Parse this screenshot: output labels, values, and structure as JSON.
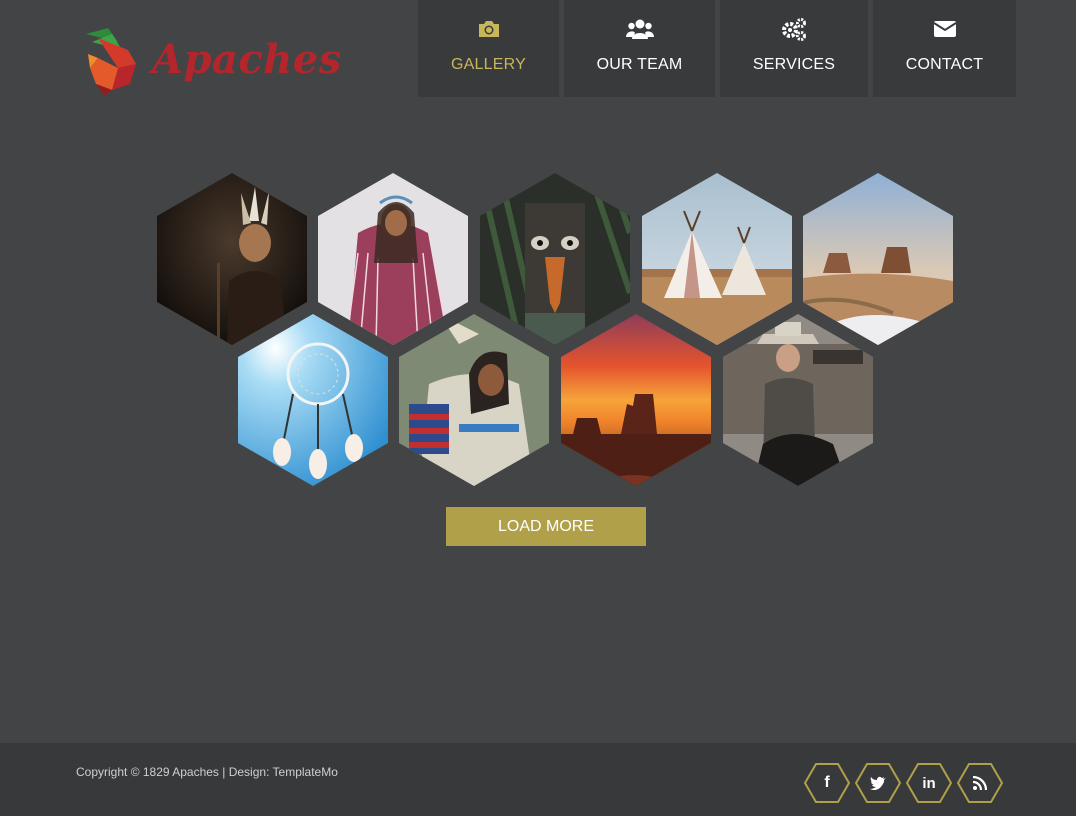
{
  "header": {
    "logo_text": "Apaches"
  },
  "nav": {
    "items": [
      {
        "label": "GALLERY",
        "icon": "camera-icon",
        "active": true
      },
      {
        "label": "OUR TEAM",
        "icon": "users-icon",
        "active": false
      },
      {
        "label": "SERVICES",
        "icon": "gears-icon",
        "active": false
      },
      {
        "label": "CONTACT",
        "icon": "envelope-icon",
        "active": false
      }
    ]
  },
  "gallery": {
    "items": [
      {
        "subject": "headdress-warrior-photo"
      },
      {
        "subject": "fringed-shawl-woman-photo"
      },
      {
        "subject": "totem-pole-photo"
      },
      {
        "subject": "teepee-camp-photo"
      },
      {
        "subject": "monument-valley-photo"
      },
      {
        "subject": "dreamcatcher-photo"
      },
      {
        "subject": "regalia-dancer-photo"
      },
      {
        "subject": "sunset-mesa-photo"
      },
      {
        "subject": "cowboy-rider-photo"
      }
    ],
    "load_more_label": "LOAD MORE"
  },
  "footer": {
    "copyright": "Copyright © 1829 Apaches | Design: TemplateMo",
    "social": [
      {
        "name": "facebook-icon",
        "glyph": "f"
      },
      {
        "name": "twitter-icon",
        "glyph": "t"
      },
      {
        "name": "linkedin-icon",
        "glyph": "in"
      },
      {
        "name": "rss-icon",
        "glyph": "rss"
      }
    ]
  },
  "colors": {
    "background": "#434446",
    "nav_tile": "#393a3c",
    "accent_gold": "#c8b65a",
    "button_gold": "#b0a04a",
    "brand_red": "#b3262b",
    "footer": "#38393a"
  }
}
